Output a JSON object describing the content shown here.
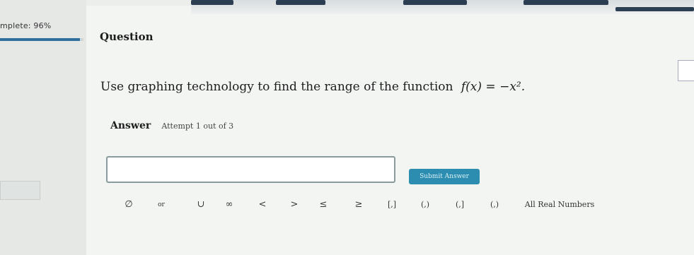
{
  "sidebar": {
    "progress_text": "mplete: 96%",
    "progress_percent": 96
  },
  "question": {
    "heading": "Question",
    "text": "Use graphing technology to find the range of the function",
    "function": "f(x) = −x²."
  },
  "answer": {
    "label": "Answer",
    "attempt": "Attempt 1 out of 3",
    "input_value": "",
    "submit_label": "Submit Answer"
  },
  "symbols": [
    {
      "label": "∅"
    },
    {
      "label": "or"
    },
    {
      "label": "∪"
    },
    {
      "label": "∞"
    },
    {
      "label": "<"
    },
    {
      "label": ">"
    },
    {
      "label": "≤"
    },
    {
      "label": "≥"
    },
    {
      "label": "[,]"
    },
    {
      "label": "(,)"
    },
    {
      "label": "(,]"
    },
    {
      "label": "(,)"
    },
    {
      "label": "All Real Numbers"
    }
  ]
}
